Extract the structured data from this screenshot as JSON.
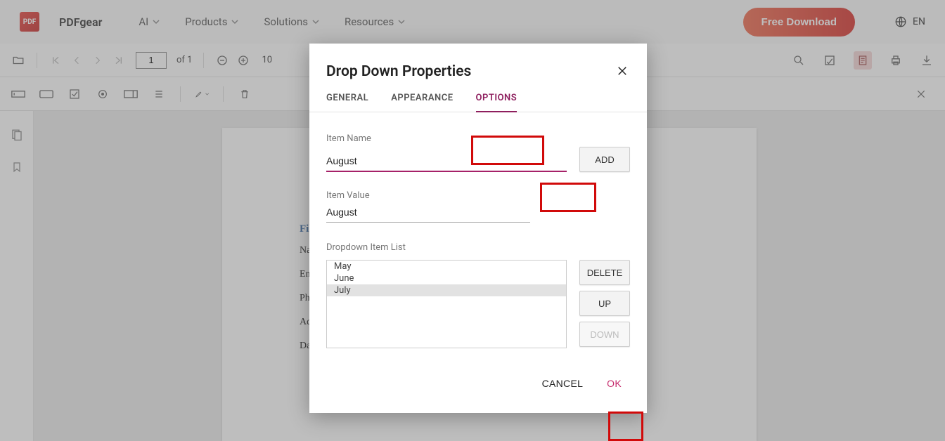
{
  "header": {
    "brand": "PDFgear",
    "logo_text": "PDF",
    "nav": {
      "ai": "AI",
      "products": "Products",
      "solutions": "Solutions",
      "resources": "Resources"
    },
    "download": "Free Download",
    "lang": "EN"
  },
  "toolbar1": {
    "page_current": "1",
    "page_total": "of 1",
    "zoom_bit": "10"
  },
  "doc": {
    "heading": "Fillab",
    "rows": {
      "name": "Name",
      "email": "Email",
      "phone": "Phone",
      "address": "Addre",
      "dob": "Date o"
    }
  },
  "dialog": {
    "title": "Drop Down Properties",
    "tabs": {
      "general": "GENERAL",
      "appearance": "APPEARANCE",
      "options": "OPTIONS"
    },
    "item_name_lbl": "Item Name",
    "item_name_val": "August",
    "add": "ADD",
    "item_value_lbl": "Item Value",
    "item_value_val": "August",
    "list_lbl": "Dropdown Item List",
    "items": [
      "May",
      "June",
      "July"
    ],
    "selected_index": 2,
    "btns": {
      "delete": "DELETE",
      "up": "UP",
      "down": "DOWN"
    },
    "cancel": "CANCEL",
    "ok": "OK"
  }
}
